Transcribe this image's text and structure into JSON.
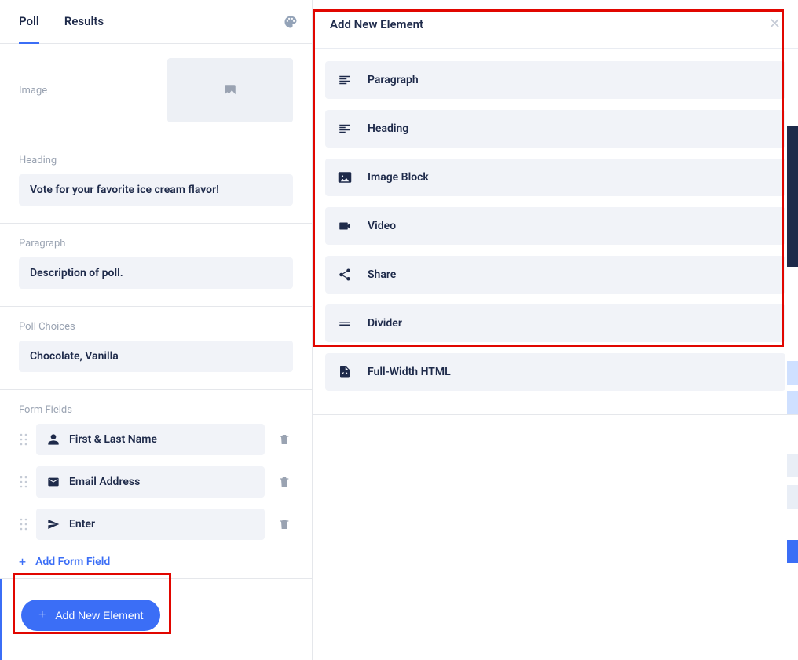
{
  "tabs": {
    "poll_label": "Poll",
    "results_label": "Results"
  },
  "sections": {
    "image_label": "Image",
    "heading_label": "Heading",
    "heading_value": "Vote for your favorite ice cream flavor!",
    "paragraph_label": "Paragraph",
    "paragraph_value": "Description of poll.",
    "poll_choices_label": "Poll Choices",
    "poll_choices_value": "Chocolate, Vanilla",
    "form_fields_label": "Form Fields",
    "add_form_field_label": "Add Form Field",
    "add_new_element_label": "Add New Element"
  },
  "form_fields": [
    {
      "icon": "person-icon",
      "label": "First & Last Name"
    },
    {
      "icon": "envelope-icon",
      "label": "Email Address"
    },
    {
      "icon": "send-icon",
      "label": "Enter"
    }
  ],
  "modal": {
    "title": "Add New Element",
    "items": [
      {
        "icon": "paragraph-align-icon",
        "label": "Paragraph"
      },
      {
        "icon": "heading-align-icon",
        "label": "Heading"
      },
      {
        "icon": "image-icon",
        "label": "Image Block"
      },
      {
        "icon": "video-icon",
        "label": "Video"
      },
      {
        "icon": "share-icon",
        "label": "Share"
      },
      {
        "icon": "divider-icon",
        "label": "Divider"
      },
      {
        "icon": "html-icon",
        "label": "Full-Width HTML"
      }
    ]
  }
}
